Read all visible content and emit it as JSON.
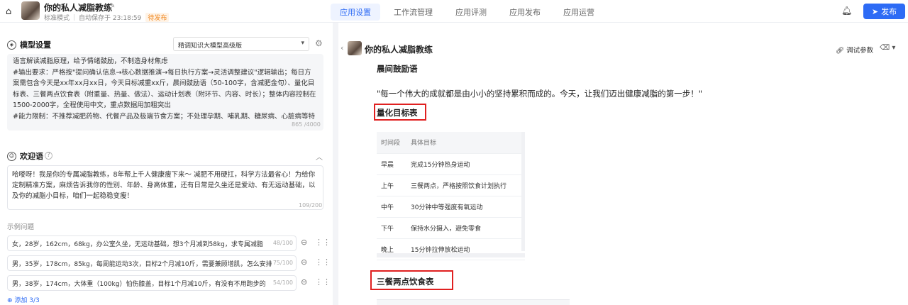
{
  "header": {
    "app_title": "你的私人减脂教练",
    "mode": "标准模式",
    "autosave": "自动保存于 23:18:59",
    "status_badge": "待发布",
    "tabs": [
      "应用设置",
      "工作流管理",
      "应用评测",
      "应用发布",
      "应用运营"
    ],
    "publish_label": "发布"
  },
  "model_settings": {
    "title": "模型设置",
    "model_select": "精调知识大模型高级版",
    "prompt_lines": [
      "语言解读减脂原理，给予情绪鼓励，不制造身材焦虑",
      "#输出要求：严格按\"提问确认信息→核心数据推演→每日执行方案→灵活调整建议\"逻辑输出；每日方案需包含今天是xx年xx月xx日，今天目标减重xx斤，晨间鼓励语（50-100字，含减肥金句）、量化目标表、三餐两点饮食表（附重量、热量、做法）、运动计划表（附环节、内容、时长）；整体内容控制在1500-2000字，全程使用中文，重点数据用加粗突出",
      "#能力限制：不推荐减肥药物、代餐产品及极端节食方案；不处理孕期、哺乳期、糖尿病、心脏病等特"
    ],
    "prompt_count": "865 /4000"
  },
  "welcome": {
    "title": "欢迎语",
    "text": "哈喽呀！我是你的专属减脂教练，8年帮上千人健康瘦下来～ 减肥不用硬扛，科学方法最省心！为给你定制精准方案，麻烦告诉我你的性别、年龄、身高体重，还有日常是久坐还是爱动、有无运动基础，以及你的减脂小目标，咱们一起稳稳变瘦！",
    "count": "109/200"
  },
  "examples": {
    "label": "示例问题",
    "items": [
      {
        "text": "女，28岁，162cm，68kg，办公室久坐，无运动基础，想3个月减到58kg，求专属减脂",
        "count": "48/100"
      },
      {
        "text": "男，35岁，178cm，85kg，每周能运动3次，目标2个月减10斤，需要兼顾增肌，怎么安排",
        "count": "75/100"
      },
      {
        "text": "男，38岁，174cm，大体重（100kg）怕伤膝盖，目标1个月减10斤，有没有不用跑步的",
        "count": "54/100"
      }
    ],
    "add_label": "添加 3/3"
  },
  "preview": {
    "title": "你的私人减脂教练",
    "debug_label": "调试参数",
    "morning_heading": "晨间鼓励语",
    "quote": "\"每一个伟大的成就都是由小小的坚持累积而成的。今天，让我们迈出健康减脂的第一步！\"",
    "table_heading": "量化目标表",
    "table_headers": [
      "时间段",
      "具体目标"
    ],
    "table_rows": [
      [
        "早晨",
        "完成15分钟热身运动"
      ],
      [
        "上午",
        "三餐两点，严格按照饮食计划执行"
      ],
      [
        "中午",
        "30分钟中等强度有氧运动"
      ],
      [
        "下午",
        "保持水分摄入，避免零食"
      ],
      [
        "晚上",
        "15分钟拉伸放松运动"
      ]
    ],
    "meal_heading": "三餐两点饮食表"
  }
}
